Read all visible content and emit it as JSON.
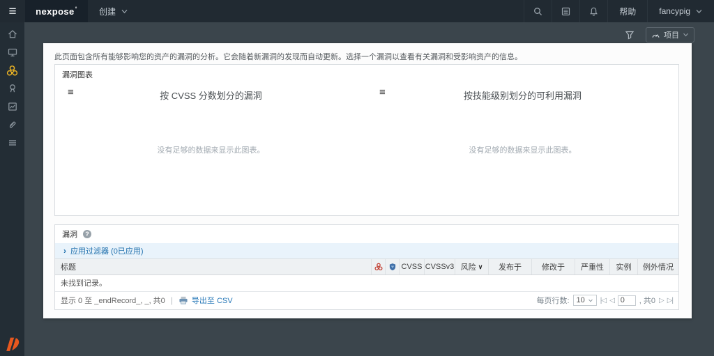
{
  "topbar": {
    "brand": "nexpose",
    "brand_mark": "°",
    "create_label": "创建",
    "help_label": "帮助",
    "user_label": "fancypig"
  },
  "toolbar": {
    "site_label": "项目"
  },
  "sidebar": {
    "items": [
      "home",
      "assets",
      "vulnerabilities",
      "policies",
      "reports",
      "tickets",
      "administration"
    ],
    "active": "vulnerabilities"
  },
  "page": {
    "description": "此页面包含所有能够影响您的资产的漏洞的分析。它会随着新漏洞的发现而自动更新。选择一个漏洞以查看有关漏洞和受影响资产的信息。"
  },
  "charts_panel": {
    "title": "漏洞图表",
    "charts": [
      {
        "title": "按 CVSS 分数划分的漏洞",
        "empty_message": "没有足够的数据来显示此图表。"
      },
      {
        "title": "按技能级别划分的可利用漏洞",
        "empty_message": "没有足够的数据来显示此图表。"
      }
    ]
  },
  "table_panel": {
    "title": "漏洞",
    "filter_label": "应用过滤器 (0已应用)",
    "columns": [
      {
        "label": "标题"
      },
      {
        "label": "",
        "icon": "malware-kit-icon"
      },
      {
        "label": "",
        "icon": "exploit-icon"
      },
      {
        "label": "CVSS"
      },
      {
        "label": "CVSSv3"
      },
      {
        "label": "风险",
        "sortable": true
      },
      {
        "label": "发布于"
      },
      {
        "label": "修改于"
      },
      {
        "label": "严重性"
      },
      {
        "label": "实例"
      },
      {
        "label": "例外情况"
      }
    ],
    "empty_message": "未找到记录。",
    "footer": {
      "showing_text": "显示 0 至 _endRecord_, _, 共0",
      "export_label": "导出至 CSV",
      "rows_per_page_label": "每页行数:",
      "rows_per_page_value": "10",
      "page_value": "0",
      "total_text": ", 共0"
    }
  },
  "glyphs": {
    "menu": "≡",
    "help": "?",
    "expander": "›",
    "sort": "∨",
    "pipe": "|",
    "pager_first": "|◁",
    "pager_prev": "◁",
    "pager_next": "▷",
    "pager_last": "▷|"
  },
  "colors": {
    "topbar_bg": "#212a32",
    "sidebar_bg": "#232d35",
    "page_bg": "#3b454c",
    "active_icon": "#edb424",
    "brand_logo": "#e8581f",
    "link": "#2a7ab9",
    "filter_bar_bg": "#e9f3fb",
    "malware_icon_red": "#c0392b",
    "exploit_icon_blue": "#3f6fa8"
  }
}
